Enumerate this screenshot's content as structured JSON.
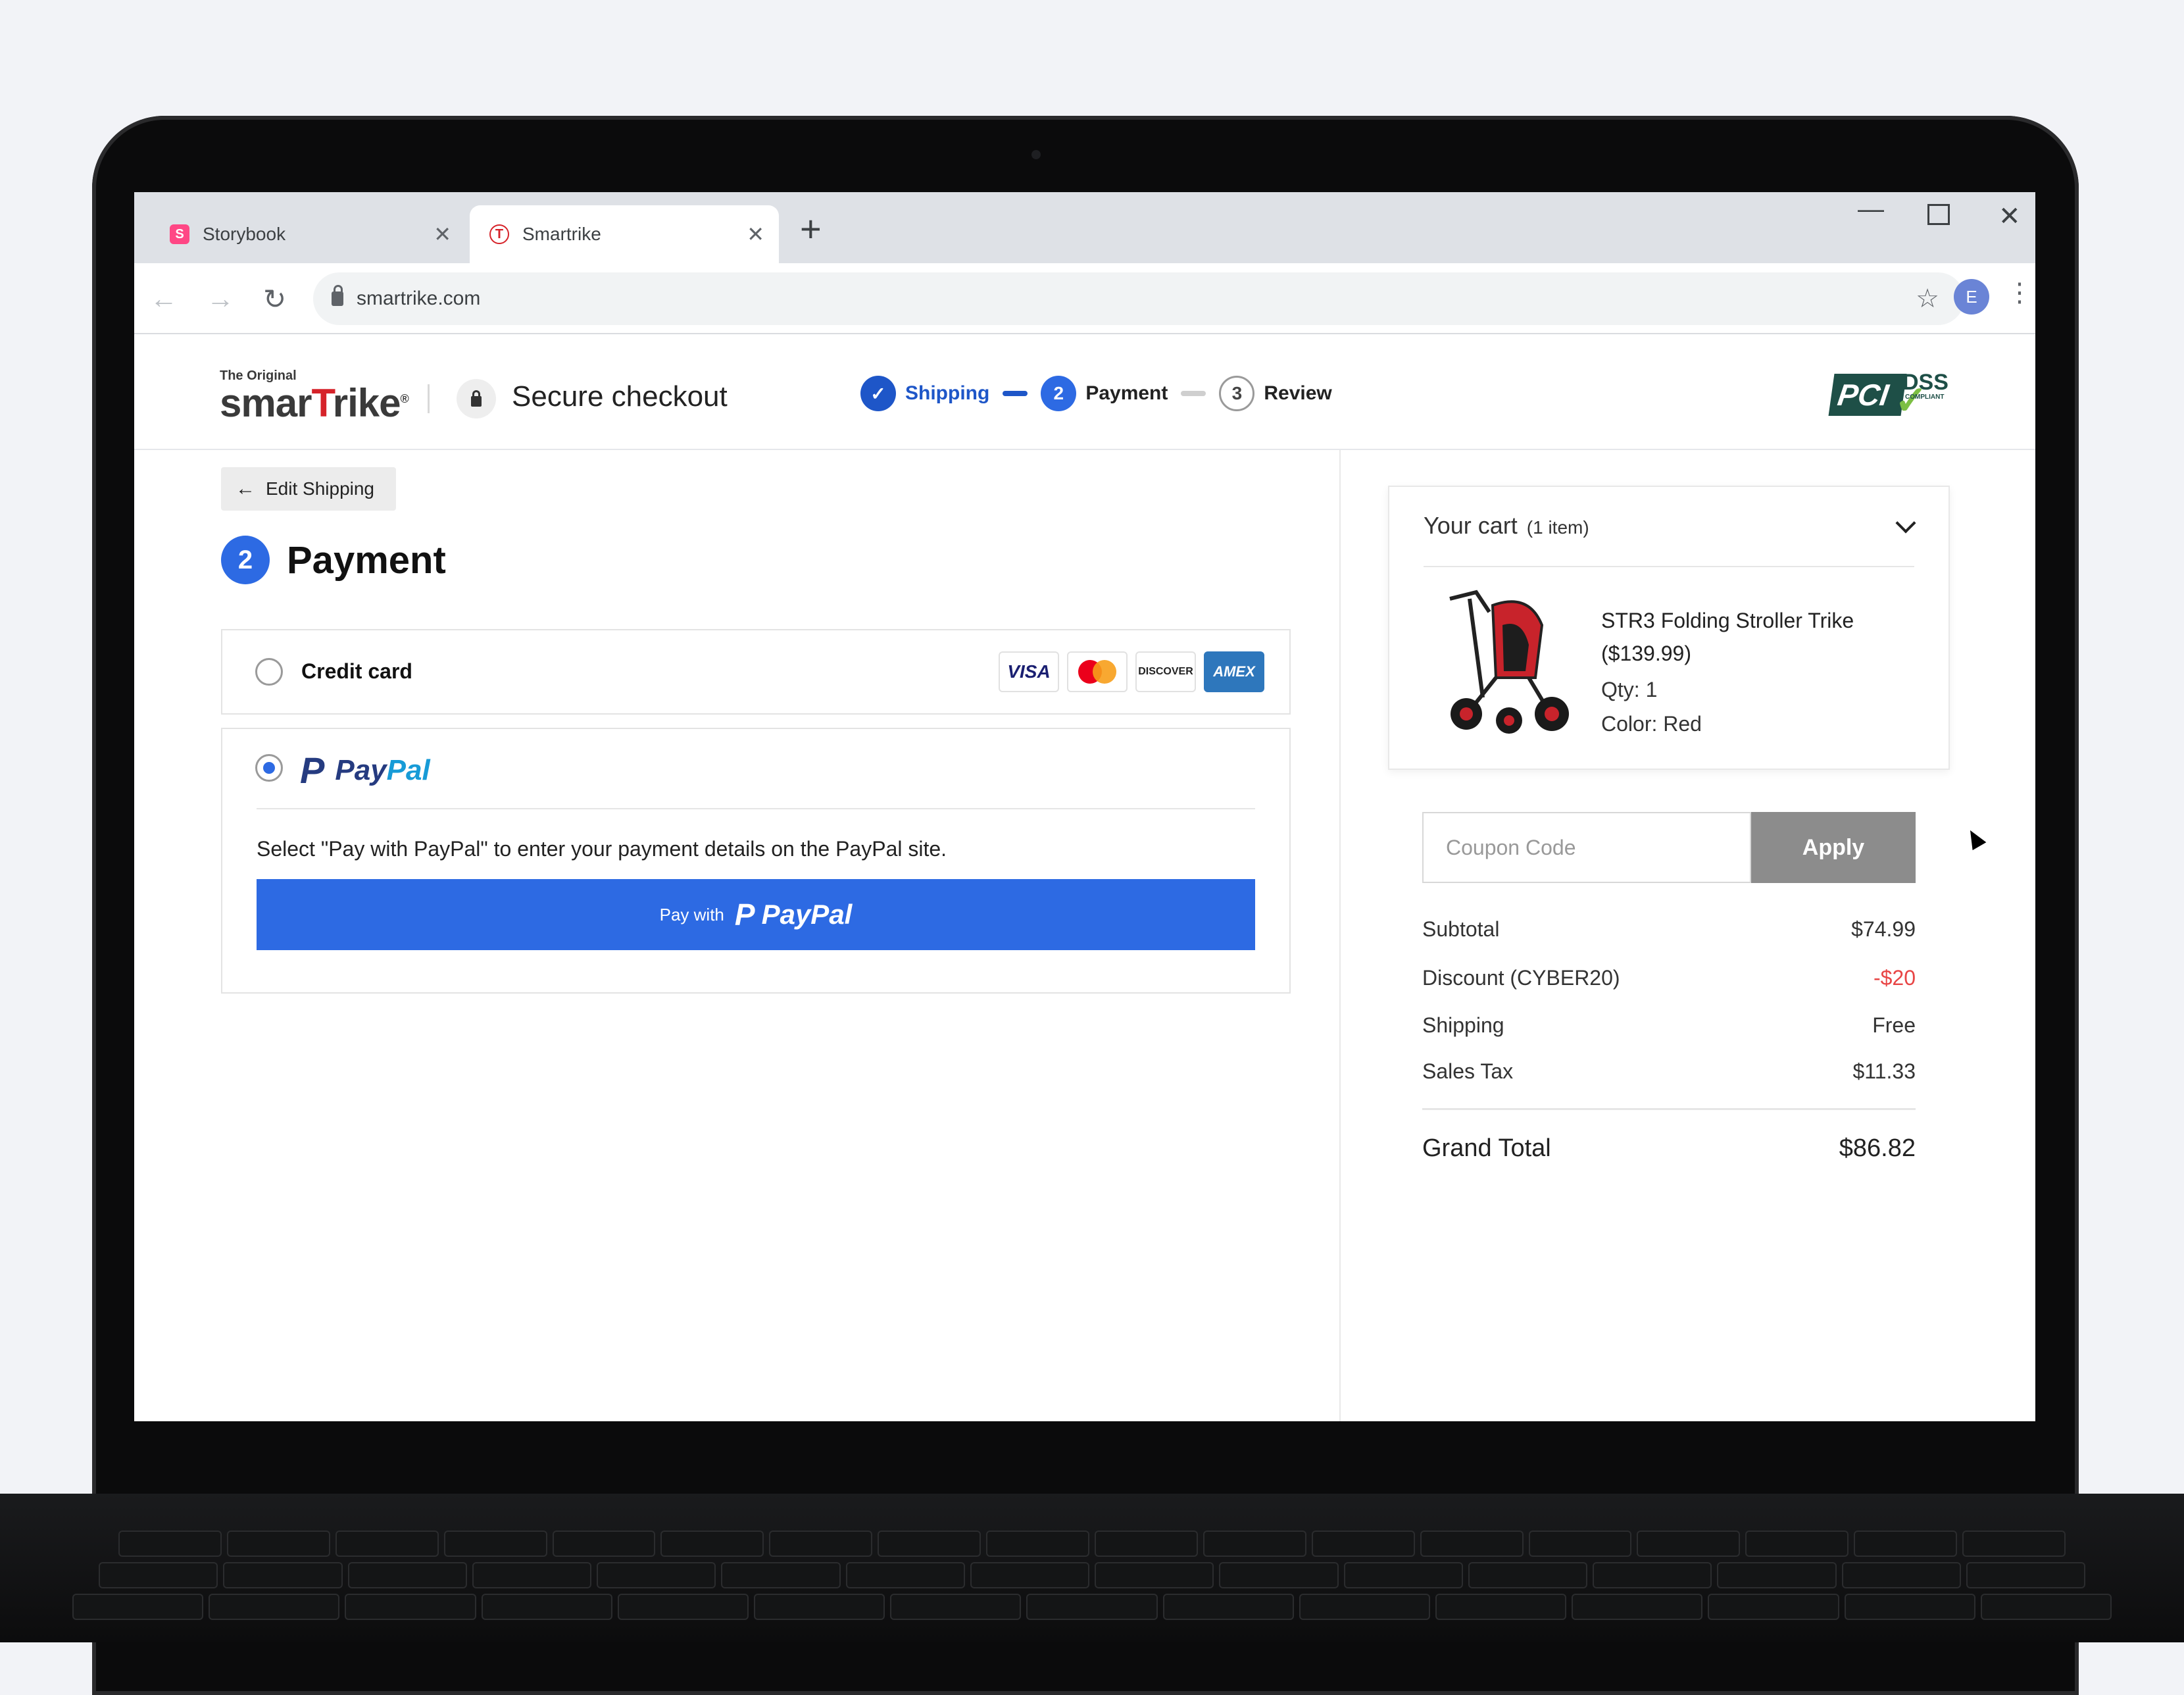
{
  "browser": {
    "tabs": [
      {
        "label": "Storybook",
        "favicon": "storybook-icon"
      },
      {
        "label": "Smartrike",
        "favicon": "smartrike-icon"
      }
    ],
    "url": "smartrike.com",
    "profile_initial": "E"
  },
  "header": {
    "logo_small": "The Original",
    "logo_part1": "smar",
    "logo_part2": "T",
    "logo_part3": "rike",
    "logo_reg": "®",
    "secure_label": "Secure checkout",
    "steps": [
      {
        "number": "",
        "label": "Shipping",
        "state": "done"
      },
      {
        "number": "2",
        "label": "Payment",
        "state": "current"
      },
      {
        "number": "3",
        "label": "Review",
        "state": "todo"
      }
    ],
    "pci": {
      "pci": "PCI",
      "dss": "DSS",
      "compliant": "COMPLIANT"
    }
  },
  "payment": {
    "edit_shipping_label": "Edit Shipping",
    "step_number": "2",
    "title": "Payment",
    "credit_card_label": "Credit card",
    "cards": [
      "VISA",
      "mastercard",
      "DISCOVER",
      "AMEX"
    ],
    "paypal": {
      "selected": true,
      "logo_pay": "Pay",
      "logo_pal": "Pal",
      "description": "Select \"Pay with PayPal\" to enter your payment details on the PayPal site.",
      "button_prefix": "Pay with",
      "button_brand": "PayPal"
    }
  },
  "cart": {
    "title": "Your cart",
    "count": "(1 item)",
    "item": {
      "name": "STR3 Folding Stroller Trike ($139.99)",
      "qty": "Qty: 1",
      "color": "Color: Red"
    },
    "coupon_placeholder": "Coupon Code",
    "apply_label": "Apply",
    "summary": [
      {
        "label": "Subtotal",
        "value": "$74.99"
      },
      {
        "label": "Discount (CYBER20)",
        "value": "-$20"
      },
      {
        "label": "Shipping",
        "value": "Free"
      },
      {
        "label": "Sales Tax",
        "value": "$11.33"
      }
    ],
    "grand_total_label": "Grand Total",
    "grand_total_value": "$86.82"
  },
  "colors": {
    "accent": "#2d6ae3",
    "discount": "#e84545",
    "apply_button": "#8c8c8c"
  }
}
